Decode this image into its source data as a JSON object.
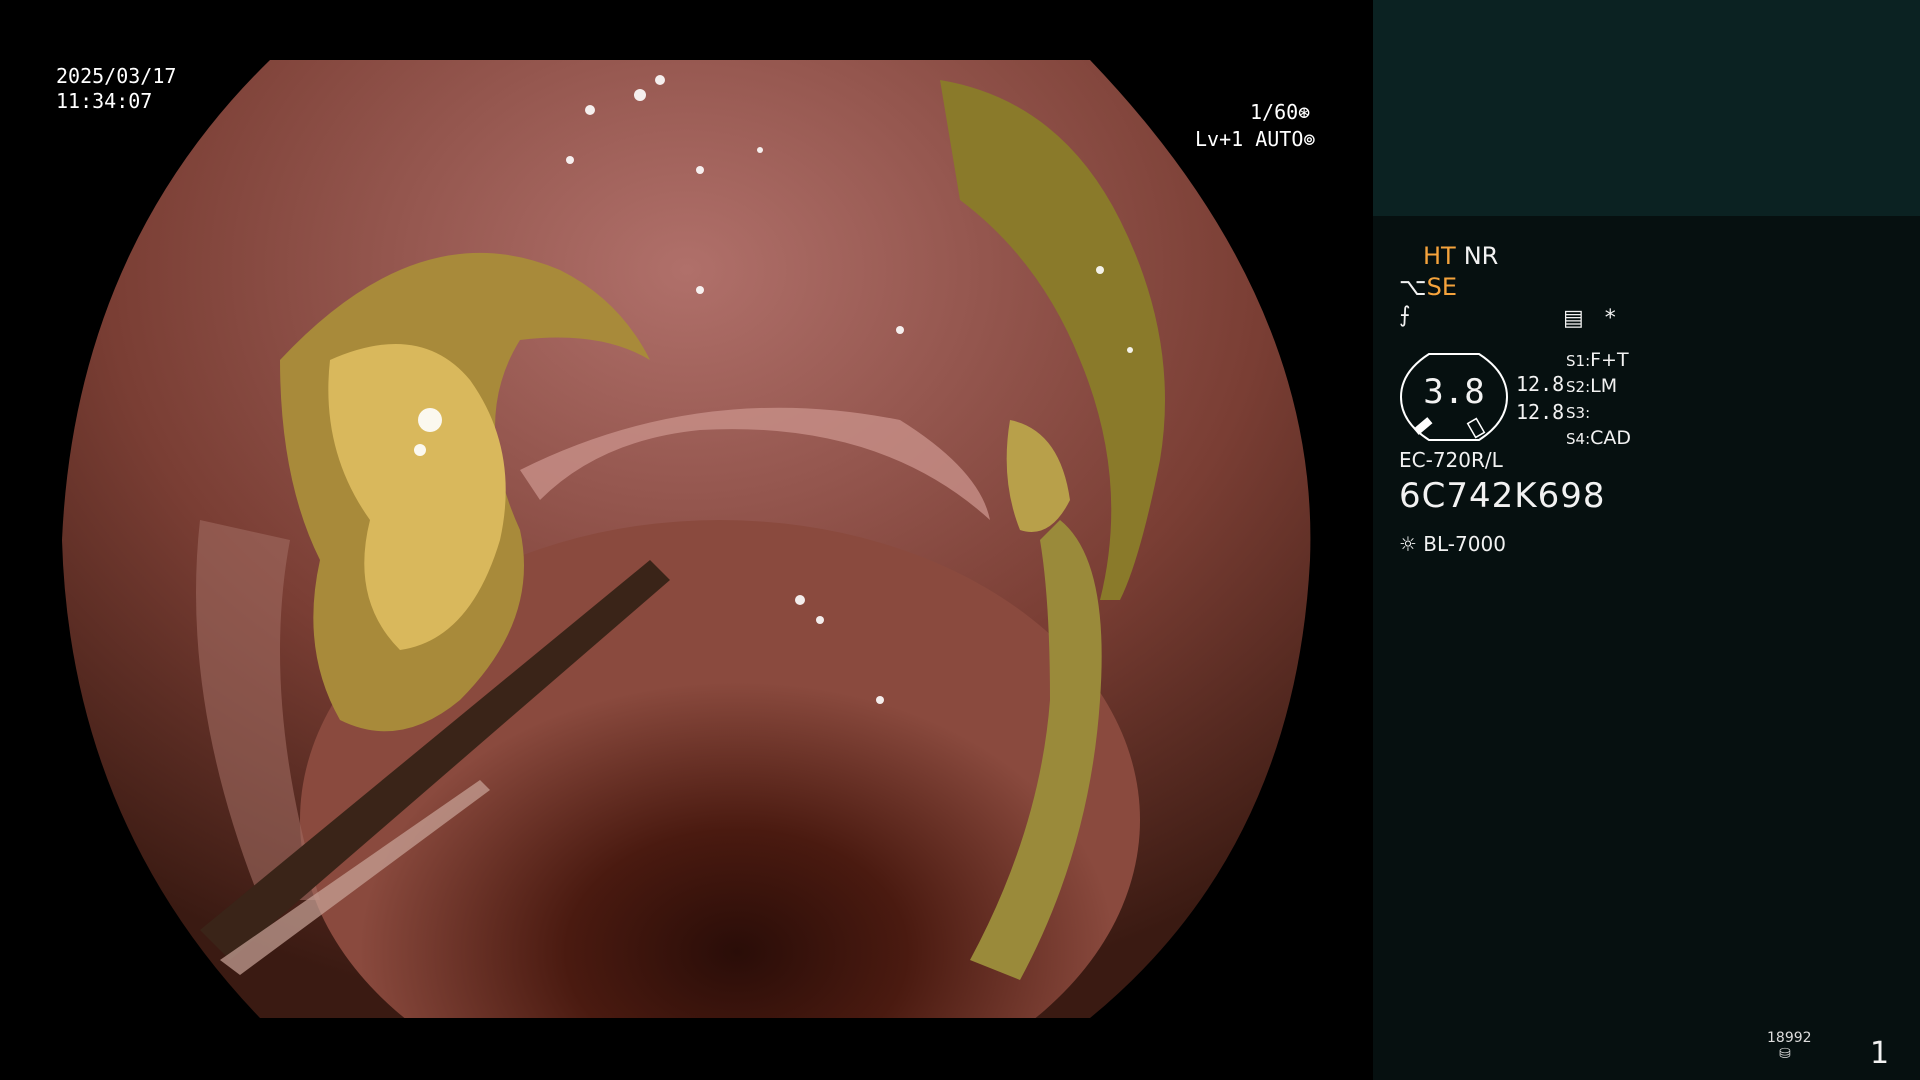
{
  "overlay": {
    "date": "2025/03/17",
    "time": "11:34:07",
    "shutter": "1/60",
    "shutter_icon": "iris-icon",
    "exposure_level": "Lv+1 AUTO",
    "exposure_icon": "auto-iris-icon"
  },
  "panel": {
    "ht": "HT",
    "nr": "NR",
    "se": "SE",
    "menu_symbol": "*",
    "dial_value": "3.8",
    "level_1": "12.8",
    "level_2": "12.8",
    "slots": [
      {
        "key": "S1:",
        "value": "F+T"
      },
      {
        "key": "S2:",
        "value": "LM"
      },
      {
        "key": "S3:",
        "value": ""
      },
      {
        "key": "S4:",
        "value": "CAD"
      }
    ],
    "scope_model": "EC-720R/L",
    "serial": "6C742K698",
    "light_source": "BL-7000",
    "storage_count": "18992",
    "page_number": "1"
  },
  "colors": {
    "accent_orange": "#f5a33c",
    "panel_bg": "#061010",
    "teal_box": "#0b2222"
  }
}
